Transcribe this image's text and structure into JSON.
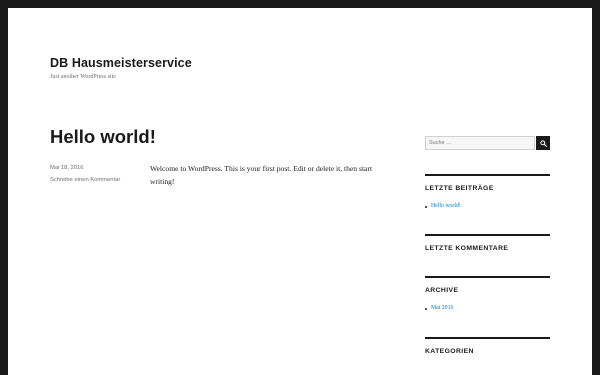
{
  "site": {
    "title": "DB Hausmeisterservice",
    "description": "Just another WordPress site"
  },
  "post": {
    "title": "Hello world!",
    "date": "Mai 18, 2016",
    "comment_link": "Schreibe einen Kommentar",
    "body": "Welcome to WordPress. This is your first post. Edit or delete it, then start writing!"
  },
  "sidebar": {
    "search": {
      "placeholder": "Suche …",
      "button_icon": "search-icon"
    },
    "recent_posts": {
      "title": "LETZTE BEITRÄGE",
      "items": [
        "Hello world!"
      ]
    },
    "recent_comments": {
      "title": "LETZTE KOMMENTARE"
    },
    "archives": {
      "title": "ARCHIVE",
      "items": [
        "Mai 2016"
      ]
    },
    "categories": {
      "title": "KATEGORIEN"
    }
  },
  "colors": {
    "link": "#007acc",
    "text": "#1a1a1a",
    "muted": "#707070",
    "frame": "#1a1a1a"
  }
}
